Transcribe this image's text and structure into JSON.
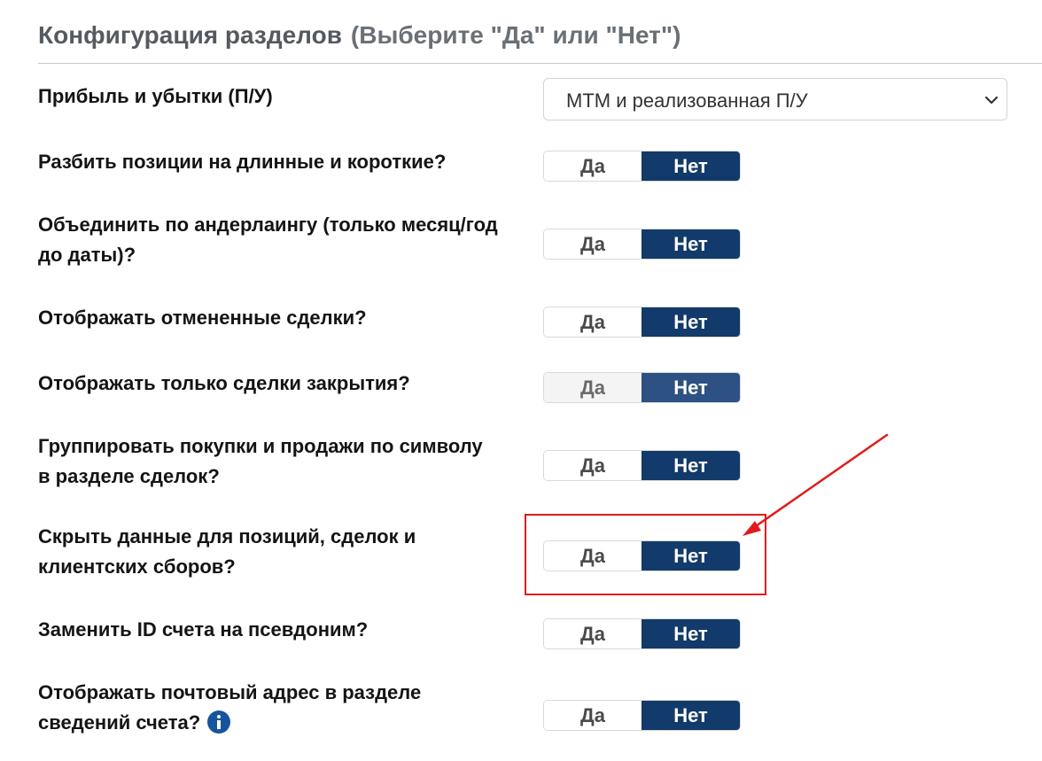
{
  "header": {
    "title": "Конфигурация разделов",
    "subtitle": "(Выберите \"Да\" или \"Нет\")"
  },
  "pnl": {
    "label": "Прибыль и убытки (П/У)",
    "selected": "МТМ и реализованная П/У"
  },
  "toggle_labels": {
    "yes": "Да",
    "no": "Нет"
  },
  "rows": [
    {
      "label": "Разбить позиции на длинные и короткие?",
      "value": "Нет"
    },
    {
      "label": "Объединить по андерлаингу (только месяц/год до даты)?",
      "value": "Нет"
    },
    {
      "label": "Отображать отмененные сделки?",
      "value": "Нет"
    },
    {
      "label": "Отображать только сделки закрытия?",
      "value": "Нет",
      "state": "disabled"
    },
    {
      "label": "Группировать покупки и продажи по символу в разделе сделок?",
      "value": "Нет"
    },
    {
      "label": "Скрыть данные для позиций, сделок и клиентских сборов?",
      "value": "Нет",
      "highlighted": true
    },
    {
      "label": "Заменить ID счета на псевдоним?",
      "value": "Нет"
    },
    {
      "label": "Отображать почтовый адрес в разделе сведений счета?",
      "value": "Нет",
      "has_info_icon": true
    }
  ],
  "colors": {
    "selected_toggle": "#123a6b",
    "disabled_toggle": "#2d5183",
    "annotation_red": "#e01b1b",
    "info_icon": "#17549e"
  }
}
